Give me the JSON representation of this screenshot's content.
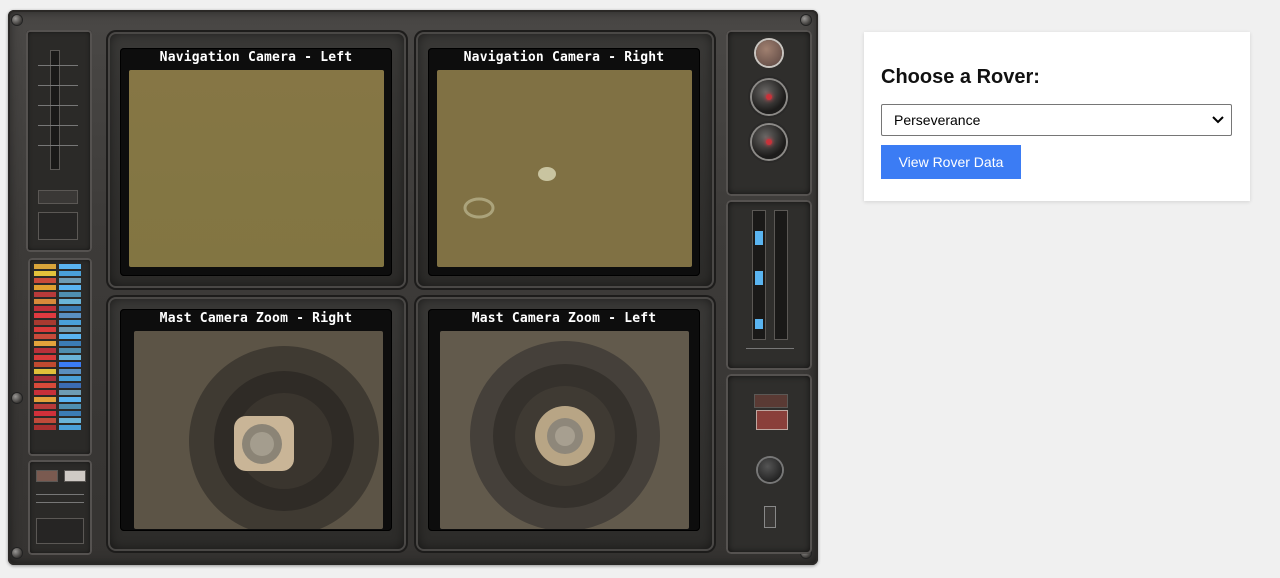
{
  "console": {
    "screens": [
      {
        "title": "Navigation Camera - Left"
      },
      {
        "title": "Navigation Camera - Right"
      },
      {
        "title": "Mast Camera Zoom - Right"
      },
      {
        "title": "Mast Camera Zoom - Left"
      }
    ],
    "colors": {
      "knob_led": "#c8323a",
      "readout": "#5ab4f0"
    }
  },
  "rover_picker": {
    "heading": "Choose a Rover:",
    "selected_rover": "Perseverance",
    "submit_label": "View Rover Data",
    "accent_color": "#3b7cf4"
  }
}
